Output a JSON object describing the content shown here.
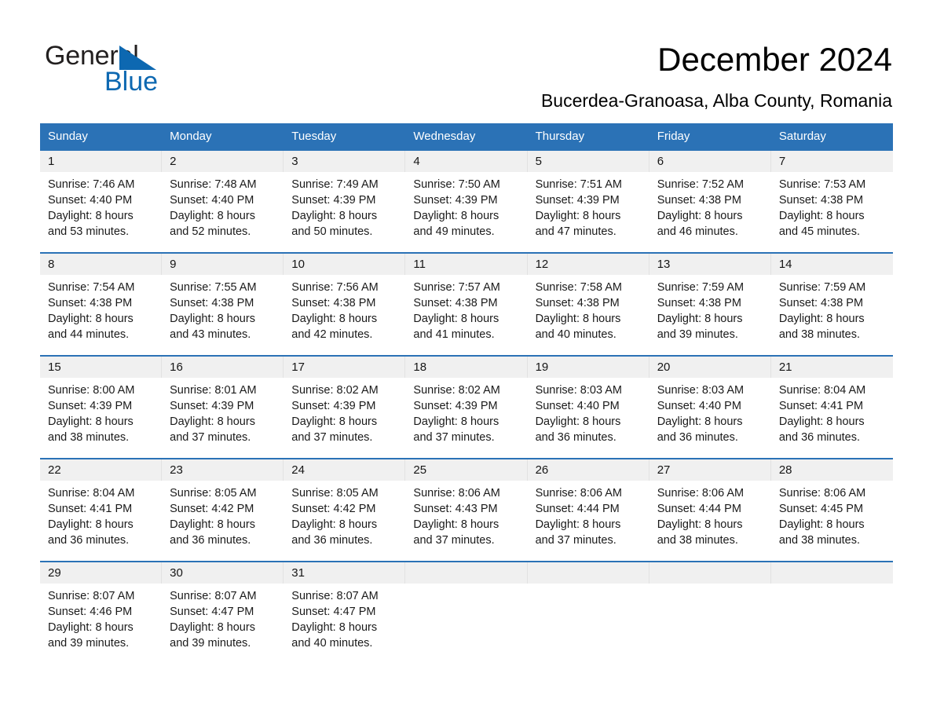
{
  "brand": {
    "name_part1": "General",
    "name_part2": "Blue",
    "triangle_color": "#0d68b1",
    "text_color": "#221f1f"
  },
  "header": {
    "title": "December 2024",
    "subtitle": "Bucerdea-Granoasa, Alba County, Romania"
  },
  "theme": {
    "header_bar_color": "#2b72b6",
    "date_band_color": "#f0f0f0",
    "rule_color": "#2b72b6",
    "text_color": "#1a1a1a"
  },
  "calendar": {
    "weekday_headers": [
      "Sunday",
      "Monday",
      "Tuesday",
      "Wednesday",
      "Thursday",
      "Friday",
      "Saturday"
    ],
    "weeks": [
      [
        {
          "day": "1",
          "sunrise": "Sunrise: 7:46 AM",
          "sunset": "Sunset: 4:40 PM",
          "daylight_line1": "Daylight: 8 hours",
          "daylight_line2": "and 53 minutes."
        },
        {
          "day": "2",
          "sunrise": "Sunrise: 7:48 AM",
          "sunset": "Sunset: 4:40 PM",
          "daylight_line1": "Daylight: 8 hours",
          "daylight_line2": "and 52 minutes."
        },
        {
          "day": "3",
          "sunrise": "Sunrise: 7:49 AM",
          "sunset": "Sunset: 4:39 PM",
          "daylight_line1": "Daylight: 8 hours",
          "daylight_line2": "and 50 minutes."
        },
        {
          "day": "4",
          "sunrise": "Sunrise: 7:50 AM",
          "sunset": "Sunset: 4:39 PM",
          "daylight_line1": "Daylight: 8 hours",
          "daylight_line2": "and 49 minutes."
        },
        {
          "day": "5",
          "sunrise": "Sunrise: 7:51 AM",
          "sunset": "Sunset: 4:39 PM",
          "daylight_line1": "Daylight: 8 hours",
          "daylight_line2": "and 47 minutes."
        },
        {
          "day": "6",
          "sunrise": "Sunrise: 7:52 AM",
          "sunset": "Sunset: 4:38 PM",
          "daylight_line1": "Daylight: 8 hours",
          "daylight_line2": "and 46 minutes."
        },
        {
          "day": "7",
          "sunrise": "Sunrise: 7:53 AM",
          "sunset": "Sunset: 4:38 PM",
          "daylight_line1": "Daylight: 8 hours",
          "daylight_line2": "and 45 minutes."
        }
      ],
      [
        {
          "day": "8",
          "sunrise": "Sunrise: 7:54 AM",
          "sunset": "Sunset: 4:38 PM",
          "daylight_line1": "Daylight: 8 hours",
          "daylight_line2": "and 44 minutes."
        },
        {
          "day": "9",
          "sunrise": "Sunrise: 7:55 AM",
          "sunset": "Sunset: 4:38 PM",
          "daylight_line1": "Daylight: 8 hours",
          "daylight_line2": "and 43 minutes."
        },
        {
          "day": "10",
          "sunrise": "Sunrise: 7:56 AM",
          "sunset": "Sunset: 4:38 PM",
          "daylight_line1": "Daylight: 8 hours",
          "daylight_line2": "and 42 minutes."
        },
        {
          "day": "11",
          "sunrise": "Sunrise: 7:57 AM",
          "sunset": "Sunset: 4:38 PM",
          "daylight_line1": "Daylight: 8 hours",
          "daylight_line2": "and 41 minutes."
        },
        {
          "day": "12",
          "sunrise": "Sunrise: 7:58 AM",
          "sunset": "Sunset: 4:38 PM",
          "daylight_line1": "Daylight: 8 hours",
          "daylight_line2": "and 40 minutes."
        },
        {
          "day": "13",
          "sunrise": "Sunrise: 7:59 AM",
          "sunset": "Sunset: 4:38 PM",
          "daylight_line1": "Daylight: 8 hours",
          "daylight_line2": "and 39 minutes."
        },
        {
          "day": "14",
          "sunrise": "Sunrise: 7:59 AM",
          "sunset": "Sunset: 4:38 PM",
          "daylight_line1": "Daylight: 8 hours",
          "daylight_line2": "and 38 minutes."
        }
      ],
      [
        {
          "day": "15",
          "sunrise": "Sunrise: 8:00 AM",
          "sunset": "Sunset: 4:39 PM",
          "daylight_line1": "Daylight: 8 hours",
          "daylight_line2": "and 38 minutes."
        },
        {
          "day": "16",
          "sunrise": "Sunrise: 8:01 AM",
          "sunset": "Sunset: 4:39 PM",
          "daylight_line1": "Daylight: 8 hours",
          "daylight_line2": "and 37 minutes."
        },
        {
          "day": "17",
          "sunrise": "Sunrise: 8:02 AM",
          "sunset": "Sunset: 4:39 PM",
          "daylight_line1": "Daylight: 8 hours",
          "daylight_line2": "and 37 minutes."
        },
        {
          "day": "18",
          "sunrise": "Sunrise: 8:02 AM",
          "sunset": "Sunset: 4:39 PM",
          "daylight_line1": "Daylight: 8 hours",
          "daylight_line2": "and 37 minutes."
        },
        {
          "day": "19",
          "sunrise": "Sunrise: 8:03 AM",
          "sunset": "Sunset: 4:40 PM",
          "daylight_line1": "Daylight: 8 hours",
          "daylight_line2": "and 36 minutes."
        },
        {
          "day": "20",
          "sunrise": "Sunrise: 8:03 AM",
          "sunset": "Sunset: 4:40 PM",
          "daylight_line1": "Daylight: 8 hours",
          "daylight_line2": "and 36 minutes."
        },
        {
          "day": "21",
          "sunrise": "Sunrise: 8:04 AM",
          "sunset": "Sunset: 4:41 PM",
          "daylight_line1": "Daylight: 8 hours",
          "daylight_line2": "and 36 minutes."
        }
      ],
      [
        {
          "day": "22",
          "sunrise": "Sunrise: 8:04 AM",
          "sunset": "Sunset: 4:41 PM",
          "daylight_line1": "Daylight: 8 hours",
          "daylight_line2": "and 36 minutes."
        },
        {
          "day": "23",
          "sunrise": "Sunrise: 8:05 AM",
          "sunset": "Sunset: 4:42 PM",
          "daylight_line1": "Daylight: 8 hours",
          "daylight_line2": "and 36 minutes."
        },
        {
          "day": "24",
          "sunrise": "Sunrise: 8:05 AM",
          "sunset": "Sunset: 4:42 PM",
          "daylight_line1": "Daylight: 8 hours",
          "daylight_line2": "and 36 minutes."
        },
        {
          "day": "25",
          "sunrise": "Sunrise: 8:06 AM",
          "sunset": "Sunset: 4:43 PM",
          "daylight_line1": "Daylight: 8 hours",
          "daylight_line2": "and 37 minutes."
        },
        {
          "day": "26",
          "sunrise": "Sunrise: 8:06 AM",
          "sunset": "Sunset: 4:44 PM",
          "daylight_line1": "Daylight: 8 hours",
          "daylight_line2": "and 37 minutes."
        },
        {
          "day": "27",
          "sunrise": "Sunrise: 8:06 AM",
          "sunset": "Sunset: 4:44 PM",
          "daylight_line1": "Daylight: 8 hours",
          "daylight_line2": "and 38 minutes."
        },
        {
          "day": "28",
          "sunrise": "Sunrise: 8:06 AM",
          "sunset": "Sunset: 4:45 PM",
          "daylight_line1": "Daylight: 8 hours",
          "daylight_line2": "and 38 minutes."
        }
      ],
      [
        {
          "day": "29",
          "sunrise": "Sunrise: 8:07 AM",
          "sunset": "Sunset: 4:46 PM",
          "daylight_line1": "Daylight: 8 hours",
          "daylight_line2": "and 39 minutes."
        },
        {
          "day": "30",
          "sunrise": "Sunrise: 8:07 AM",
          "sunset": "Sunset: 4:47 PM",
          "daylight_line1": "Daylight: 8 hours",
          "daylight_line2": "and 39 minutes."
        },
        {
          "day": "31",
          "sunrise": "Sunrise: 8:07 AM",
          "sunset": "Sunset: 4:47 PM",
          "daylight_line1": "Daylight: 8 hours",
          "daylight_line2": "and 40 minutes."
        },
        {
          "day": "",
          "sunrise": "",
          "sunset": "",
          "daylight_line1": "",
          "daylight_line2": ""
        },
        {
          "day": "",
          "sunrise": "",
          "sunset": "",
          "daylight_line1": "",
          "daylight_line2": ""
        },
        {
          "day": "",
          "sunrise": "",
          "sunset": "",
          "daylight_line1": "",
          "daylight_line2": ""
        },
        {
          "day": "",
          "sunrise": "",
          "sunset": "",
          "daylight_line1": "",
          "daylight_line2": ""
        }
      ]
    ]
  }
}
